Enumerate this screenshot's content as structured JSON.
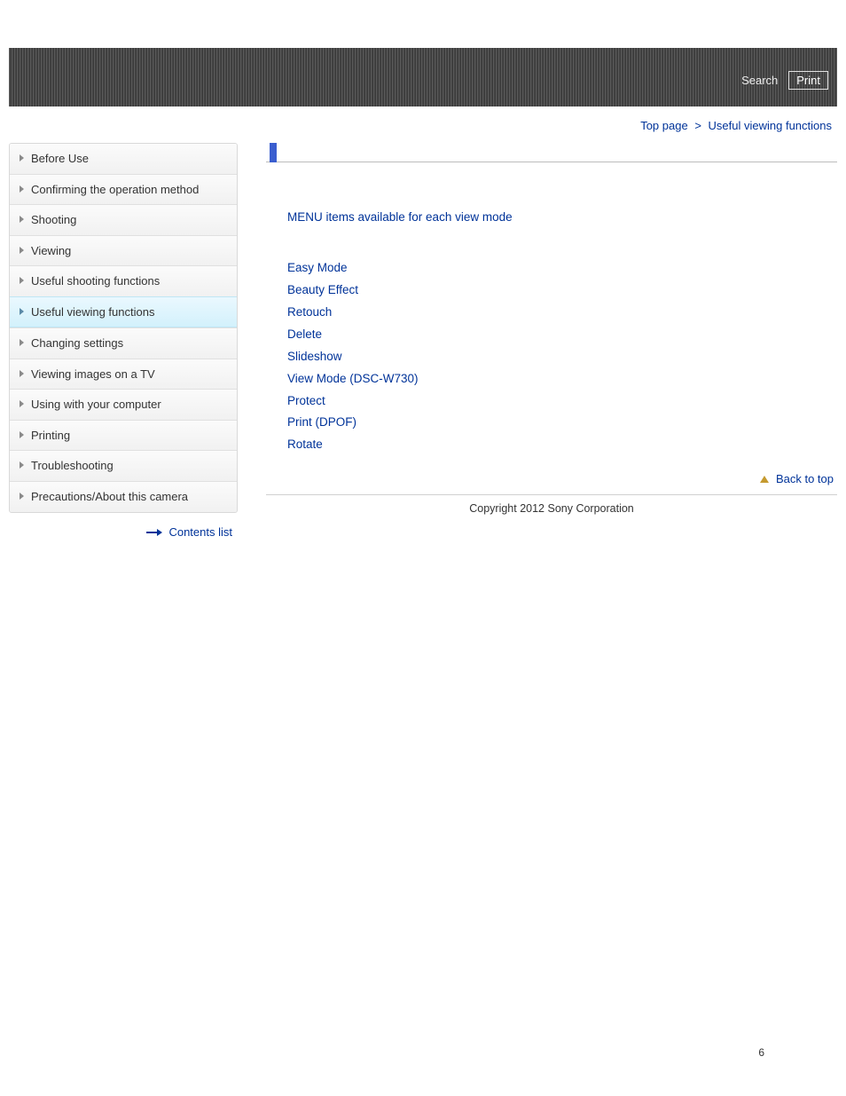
{
  "header": {
    "search_label": "Search",
    "print_label": "Print"
  },
  "breadcrumb": {
    "top": "Top page",
    "current": "Useful viewing functions"
  },
  "sidebar": {
    "items": [
      {
        "label": "Before Use",
        "active": false
      },
      {
        "label": "Confirming the operation method",
        "active": false
      },
      {
        "label": "Shooting",
        "active": false
      },
      {
        "label": "Viewing",
        "active": false
      },
      {
        "label": "Useful shooting functions",
        "active": false
      },
      {
        "label": "Useful viewing functions",
        "active": true
      },
      {
        "label": "Changing settings",
        "active": false
      },
      {
        "label": "Viewing images on a TV",
        "active": false
      },
      {
        "label": "Using with your computer",
        "active": false
      },
      {
        "label": "Printing",
        "active": false
      },
      {
        "label": "Troubleshooting",
        "active": false
      },
      {
        "label": "Precautions/About this camera",
        "active": false
      }
    ],
    "contents_list": "Contents list"
  },
  "main": {
    "section_head": "MENU items available for each view mode",
    "links": [
      "Easy Mode",
      "Beauty Effect",
      "Retouch",
      "Delete",
      "Slideshow",
      "View Mode (DSC-W730)",
      "Protect",
      "Print (DPOF)",
      "Rotate"
    ],
    "back_to_top": "Back to top"
  },
  "footer": {
    "copyright": "Copyright 2012 Sony Corporation",
    "page_number": "6"
  }
}
